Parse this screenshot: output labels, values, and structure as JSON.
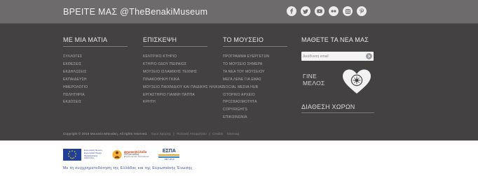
{
  "header": {
    "find_us": "ΒΡΕΙΤΕ ΜΑΣ  @TheBenakiMuseum",
    "social": [
      {
        "name": "facebook-icon",
        "glyph": "f"
      },
      {
        "name": "twitter-icon",
        "glyph": "t"
      },
      {
        "name": "youtube-icon",
        "glyph": "▶"
      },
      {
        "name": "flickr-icon",
        "glyph": "••"
      },
      {
        "name": "instagram-icon",
        "glyph": "◻"
      },
      {
        "name": "pinterest-icon",
        "glyph": "p"
      }
    ]
  },
  "columns": [
    {
      "title": "ΜΕ ΜΙΑ ΜΑΤΙΑ",
      "items": [
        "ΣΥΛΛΟΓΕΣ",
        "ΕΚΘΕΣΕΙΣ",
        "ΕΚΔΗΛΩΣΕΙΣ",
        "ΕΚΠΑΙΔΕΥΣΗ",
        "ΗΜΕΡΟΛΟΓΙΟ",
        "ΠΩΛΗΤΗΡΙΑ",
        "ΕΚΔΟΣΕΙΣ"
      ]
    },
    {
      "title": "ΕΠΙΣΚΕΨΗ",
      "items": [
        "ΚΕΝΤΡΙΚΟ ΚΤΗΡΙΟ",
        "ΚΤΗΡΙΟ ΟΔΟΥ ΠΕΙΡΑΙΩΣ",
        "ΜΟΥΣΕΙΟ ΙΣΛΑΜΙΚΗΣ ΤΕΧΝΗΣ",
        "ΠΙΝΑΚΟΘΗΚΗ ΓΚΙΚΑ",
        "ΜΟΥΣΕΙΟ ΠΑΙΧΝΙΔΙΟΥ ΚΑΙ ΠΑΙΔΙΚΗΣ ΗΛΙΚΙΑΣ",
        "ΕΡΓΑΣΤΗΡΙΟ ΓΙΑΝΝΗ ΠΑΠΠΑ",
        "ΚΡΗΤΗ"
      ]
    },
    {
      "title": "ΤΟ ΜΟΥΣΕΙΟ",
      "items": [
        "ΠΡΟΓΡΑΜΜΑ ΕΥΕΡΓΕΤΩΝ",
        "ΤΟ ΜΟΥΣΕΙΟ ΣΗΜΕΡΑ",
        "ΤΑ ΝΕΑ ΤΟΥ ΜΟΥΣΕΙΟΥ",
        "ΜΕΓΑ ΛΕΝΕ ΓΙΑ ΕΜΑΣ",
        "SOCIAL MEDIA HUB",
        "ΙΣΤΟΡΙΚΟ ΑΡΧΕΙΟ",
        "ΠΡΟΣΒΑΣΙΜΟΤΗΤΑ",
        "COPYRIGHTS",
        "ΕΠΙΚΟΙΝΩΝΙΑ"
      ]
    }
  ],
  "newsletter": {
    "title": "ΜΑΘΕΤΕ ΤΑ ΝΕΑ ΜΑΣ",
    "placeholder": "Διεύθυνση email",
    "value": ""
  },
  "member": {
    "line1": "ΓΙΝΕ",
    "line2": "ΜΕΛΟΣ"
  },
  "rentals": "ΔΙΑΘΕΣΗ ΧΩΡΩΝ",
  "copyright": {
    "text": "Copyright © 2016 Μουσείο Μπενάκη. All rights reserved.",
    "links": [
      "Όροι Χρήσης",
      "Πολιτική Απορρήτου",
      "Credits",
      "Sitemap"
    ],
    "separator": "|"
  },
  "funding": {
    "eu_text": [
      "Ευρωπαϊκή Ένωση",
      "Ευρωπαϊκό Ταμείο",
      "Περιφερειακής",
      "Ανάπτυξης"
    ],
    "ep_text": [
      "ψηφιακήΕλλάδα",
      "ΟΠ για όλους",
      "Επιχειρησιακό Πρόγραμμα"
    ],
    "espa_text": [
      "ΕΣΠΑ",
      "2007-2013"
    ],
    "caption": "Με τη συγχρηματοδότηση της Ελλάδας και της Ευρωπαϊκής Ένωσης"
  },
  "colors": {
    "top_bar": "#6d6b6b",
    "main_bg": "#434141",
    "funding_caption": "#3b4fa0"
  }
}
